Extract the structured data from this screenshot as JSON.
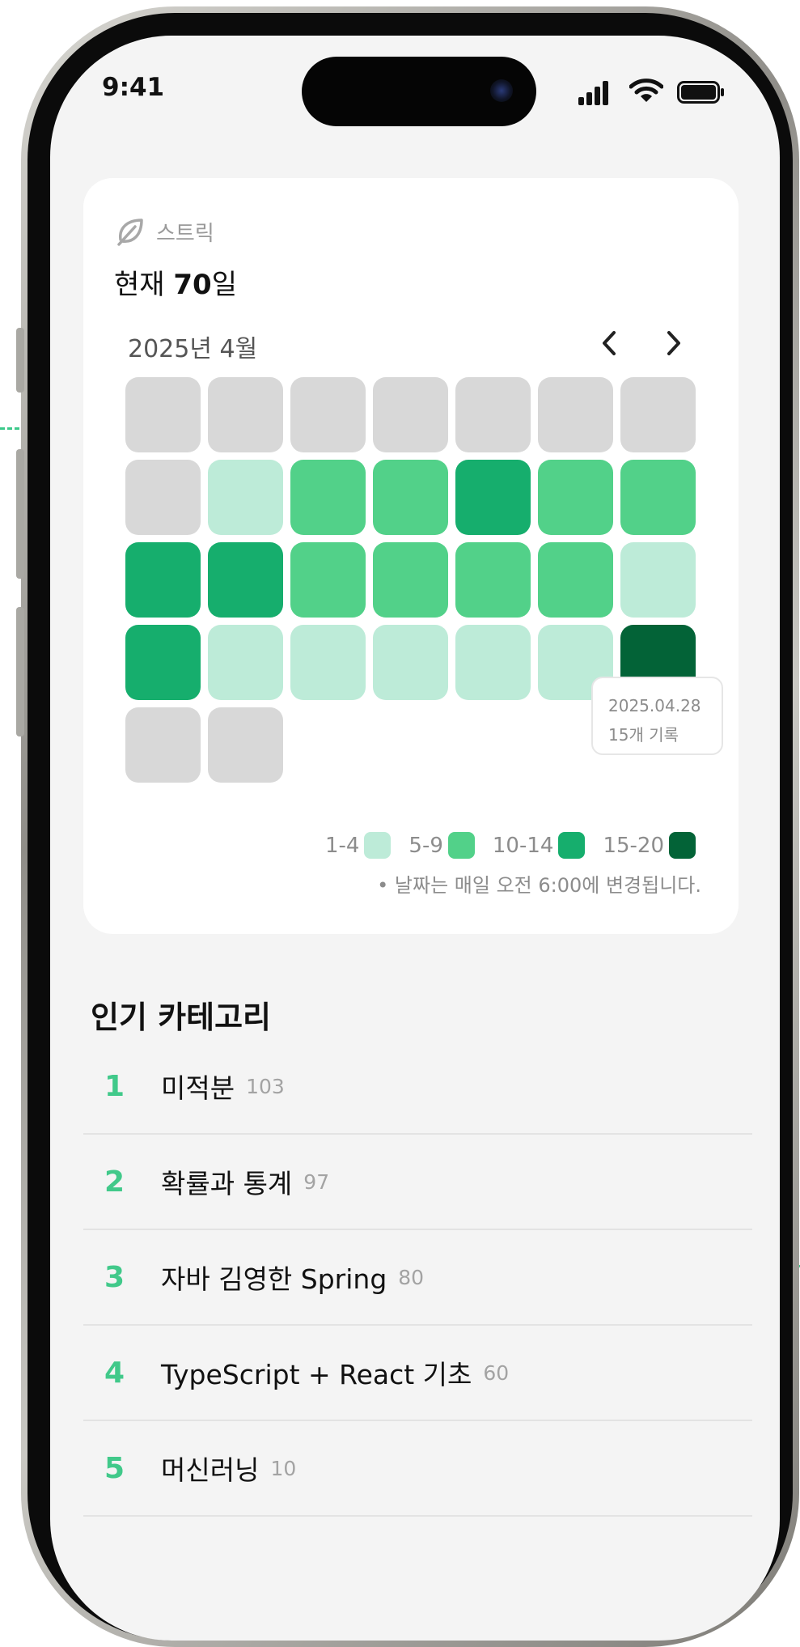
{
  "status_bar": {
    "time": "9:41"
  },
  "streak": {
    "icon": "leaf-icon",
    "label": "스트릭",
    "current_prefix": "현재 ",
    "current_value": "70",
    "current_suffix": "일",
    "month": "2025년 4월",
    "prev_icon": "chevron-left-icon",
    "next_icon": "chevron-right-icon",
    "calendar_levels": [
      0,
      0,
      0,
      0,
      0,
      0,
      0,
      0,
      1,
      2,
      2,
      3,
      2,
      2,
      3,
      3,
      2,
      2,
      2,
      2,
      1,
      3,
      1,
      1,
      1,
      1,
      1,
      4,
      0,
      0
    ],
    "level_colors": [
      "#d8d8d8",
      "#bdebd8",
      "#52d189",
      "#16ae6d",
      "#036337"
    ],
    "tooltip": {
      "date": "2025.04.28",
      "count": "15개 기록"
    },
    "legend": [
      {
        "range": "1-4",
        "color": "#bdebd8"
      },
      {
        "range": "5-9",
        "color": "#52d189"
      },
      {
        "range": "10-14",
        "color": "#16ae6d"
      },
      {
        "range": "15-20",
        "color": "#036337"
      }
    ],
    "note": "• 날짜는 매일 오전 6:00에 변경됩니다."
  },
  "popular": {
    "title": "인기 카테고리",
    "items": [
      {
        "rank": "1",
        "name": "미적분",
        "count": "103"
      },
      {
        "rank": "2",
        "name": "확률과 통계",
        "count": "97"
      },
      {
        "rank": "3",
        "name": "자바 김영한 Spring",
        "count": "80"
      },
      {
        "rank": "4",
        "name": "TypeScript + React 기초",
        "count": "60"
      },
      {
        "rank": "5",
        "name": "머신러닝",
        "count": "10"
      }
    ]
  }
}
